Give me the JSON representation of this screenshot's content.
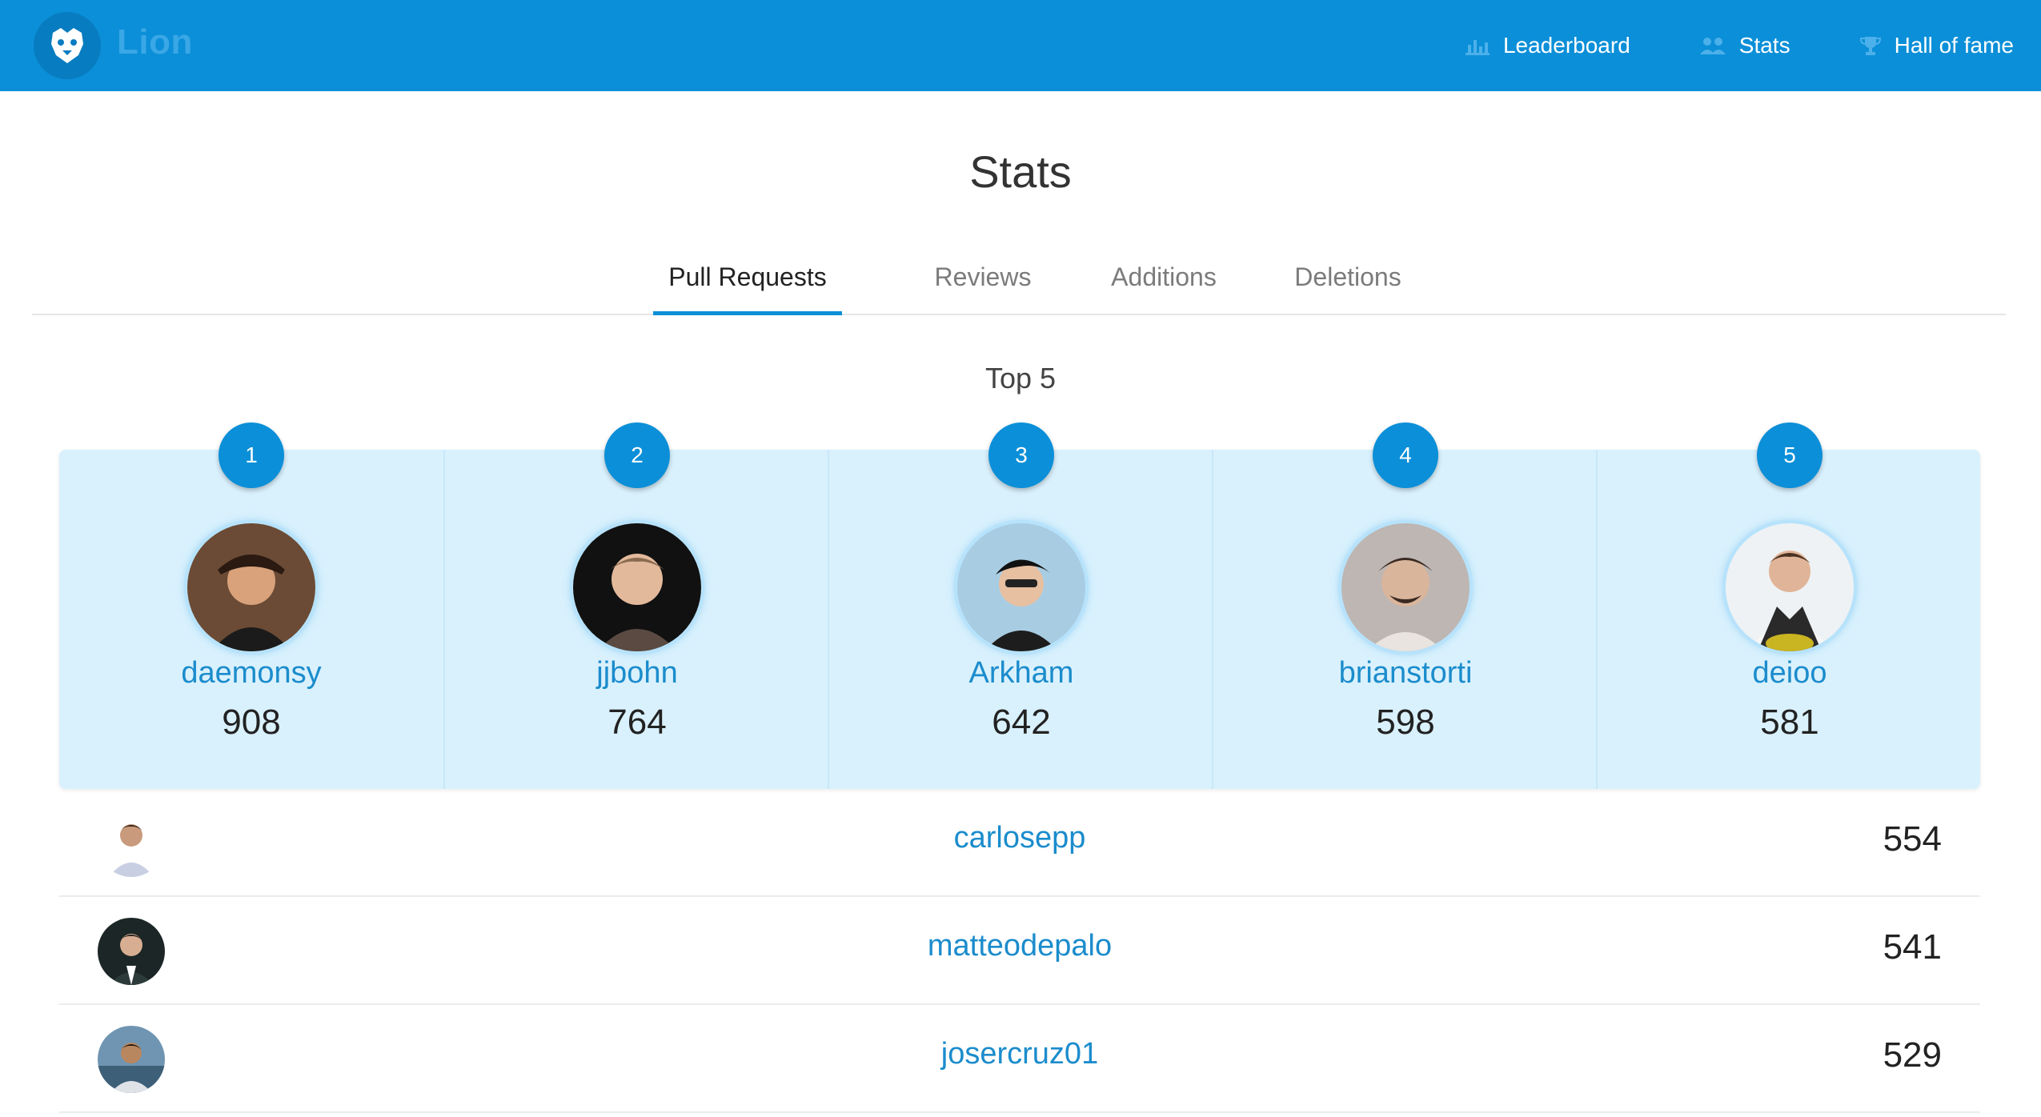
{
  "app": {
    "name": "Lion"
  },
  "nav": {
    "items": [
      {
        "label": "Leaderboard",
        "icon": "bar-chart-icon"
      },
      {
        "label": "Stats",
        "icon": "users-icon"
      },
      {
        "label": "Hall of fame",
        "icon": "trophy-icon"
      }
    ]
  },
  "page": {
    "title": "Stats",
    "top_label": "Top 5"
  },
  "tabs": [
    {
      "label": "Pull Requests",
      "active": true
    },
    {
      "label": "Reviews",
      "active": false
    },
    {
      "label": "Additions",
      "active": false
    },
    {
      "label": "Deletions",
      "active": false
    }
  ],
  "top5": [
    {
      "rank": "1",
      "name": "daemonsy",
      "score": "908",
      "avatar_color": "#5a3a2a"
    },
    {
      "rank": "2",
      "name": "jjbohn",
      "score": "764",
      "avatar_color": "#1a1a1a"
    },
    {
      "rank": "3",
      "name": "Arkham",
      "score": "642",
      "avatar_color": "#9fc6de"
    },
    {
      "rank": "4",
      "name": "brianstorti",
      "score": "598",
      "avatar_color": "#b9b3b0"
    },
    {
      "rank": "5",
      "name": "deioo",
      "score": "581",
      "avatar_color": "#e6ecef"
    }
  ],
  "others": [
    {
      "name": "carlosepp",
      "score": "554",
      "avatar_color": "#dfe4ea"
    },
    {
      "name": "matteodepalo",
      "score": "541",
      "avatar_color": "#1f2a2a"
    },
    {
      "name": "josercruz01",
      "score": "529",
      "avatar_color": "#4d7b9c"
    }
  ],
  "colors": {
    "topbar": "#0b8fd8",
    "accent": "#0b8fd8",
    "link": "#1b8ccc",
    "podium_bg": "#d9f1fd"
  }
}
